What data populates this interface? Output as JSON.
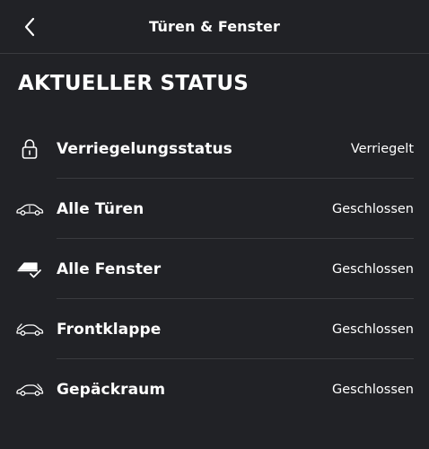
{
  "header": {
    "title": "Türen & Fenster",
    "back_icon": "chevron-left-icon"
  },
  "section": {
    "title": "AKTUELLER STATUS"
  },
  "status_items": [
    {
      "label": "Verriegelungsstatus",
      "value": "Verriegelt",
      "icon": "lock-icon"
    },
    {
      "label": "Alle Türen",
      "value": "Geschlossen",
      "icon": "car-doors-icon"
    },
    {
      "label": "Alle Fenster",
      "value": "Geschlossen",
      "icon": "window-check-icon"
    },
    {
      "label": "Frontklappe",
      "value": "Geschlossen",
      "icon": "car-hood-icon"
    },
    {
      "label": "Gepäckraum",
      "value": "Geschlossen",
      "icon": "car-trunk-icon"
    }
  ],
  "colors": {
    "background": "#212226",
    "divider": "#3a3b3f",
    "text": "#ffffff"
  }
}
